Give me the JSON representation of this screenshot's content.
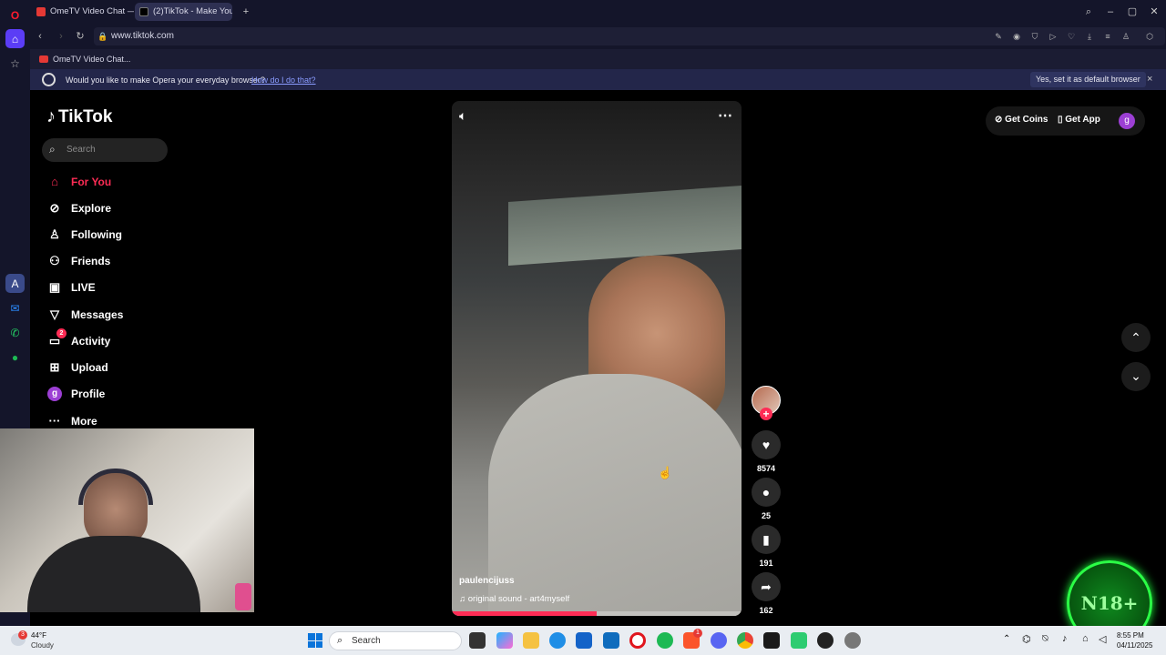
{
  "browser": {
    "tabs": [
      {
        "title": "OmeTV Video Chat — Or",
        "active": false
      },
      {
        "title": "(2)TikTok - Make Your",
        "active": true
      }
    ],
    "new_tab_symbol": "+",
    "url": "www.tiktok.com",
    "bookmark": "OmeTV Video Chat...",
    "prompt": {
      "question": "Would you like to make Opera your everyday browser?",
      "link": "How do I do that?",
      "accept": "Yes, set it as default browser",
      "close": "×"
    }
  },
  "tiktok": {
    "logo": "TikTok",
    "search_placeholder": "Search",
    "nav": [
      {
        "label": "For You",
        "icon": "home-icon",
        "glyph": "⌂",
        "active": true
      },
      {
        "label": "Explore",
        "icon": "compass-icon",
        "glyph": "⊘",
        "active": false
      },
      {
        "label": "Following",
        "icon": "user-follow-icon",
        "glyph": "♙",
        "active": false
      },
      {
        "label": "Friends",
        "icon": "friends-icon",
        "glyph": "⚇",
        "active": false
      },
      {
        "label": "LIVE",
        "icon": "live-icon",
        "glyph": "▣",
        "active": false
      },
      {
        "label": "Messages",
        "icon": "messages-icon",
        "glyph": "▽",
        "active": false
      },
      {
        "label": "Activity",
        "icon": "activity-icon",
        "glyph": "▭",
        "active": false
      },
      {
        "label": "Upload",
        "icon": "upload-icon",
        "glyph": "⊞",
        "active": false
      },
      {
        "label": "Profile",
        "icon": "profile-avatar",
        "glyph": "g",
        "active": false
      },
      {
        "label": "More",
        "icon": "more-icon",
        "glyph": "···",
        "active": false
      }
    ],
    "activity_badge": "2",
    "header": {
      "get_coins": "Get Coins",
      "get_app": "Get App",
      "avatar_letter": "g"
    },
    "video": {
      "username": "paulencijuss",
      "sound": "original sound - art4myself",
      "progress": 0.5
    },
    "actions": {
      "likes": "8574",
      "comments": "25",
      "saves": "191",
      "shares": "162"
    },
    "badge_text": "N18+"
  },
  "taskbar": {
    "weather_temp": "44°F",
    "weather_desc": "Cloudy",
    "search": "Search",
    "clock_time": "8:55 PM",
    "clock_date": "04/11/2025",
    "opera_badge": "3",
    "brave_badge": "1"
  },
  "colors": {
    "accent": "#fe2c55",
    "chrome": "#14152a",
    "badge_green": "#1aff3a"
  }
}
